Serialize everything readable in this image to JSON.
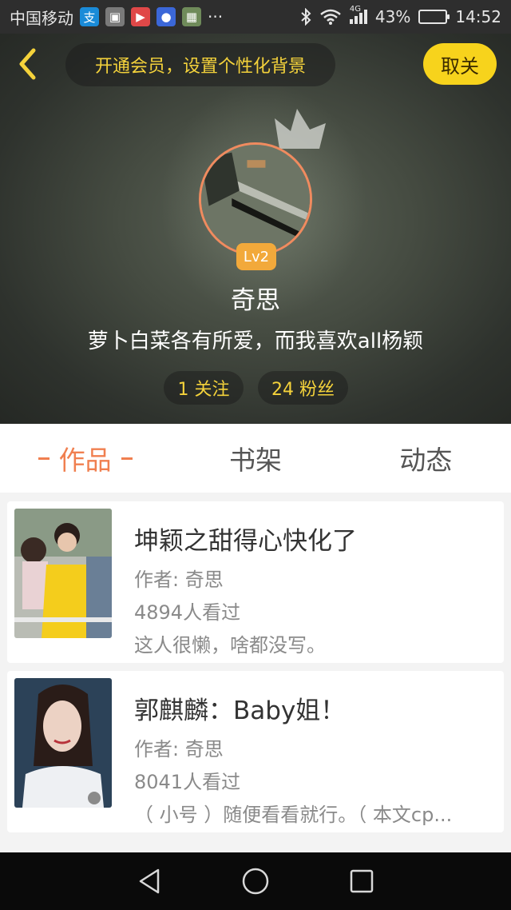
{
  "status_bar": {
    "carrier": "中国移动",
    "app_icons": [
      "alipay-icon",
      "gallery-icon",
      "video-app-icon",
      "baidu-icon",
      "map-app-icon"
    ],
    "more": "···",
    "network": "4G",
    "battery_percent": "43%",
    "battery_level": 0.43,
    "time": "14:52"
  },
  "header": {
    "vip_banner": "开通会员，设置个性化背景",
    "close_label": "取关",
    "level": "Lv2",
    "username": "奇思",
    "bio": "萝卜白菜各有所爱，而我喜欢all杨颖",
    "following_label": "1 关注",
    "followers_label": "24 粉丝"
  },
  "tabs": {
    "works": "作品",
    "bookshelf": "书架",
    "activity": "动态",
    "active": "works"
  },
  "works": [
    {
      "title": "坤颖之甜得心快化了",
      "author": "作者: 奇思",
      "views": "4894人看过",
      "description": "这人很懒，啥都没写。"
    },
    {
      "title": "郭麒麟：Baby姐！",
      "author": "作者: 奇思",
      "views": "8041人看过",
      "description": "（ 小号 ）随便看看就行。（ 本文cp..."
    }
  ],
  "colors": {
    "accent": "#f07f4f",
    "vip_yellow": "#f4d23b",
    "close_button": "#f7d31c",
    "level_badge": "#f2a93b"
  }
}
